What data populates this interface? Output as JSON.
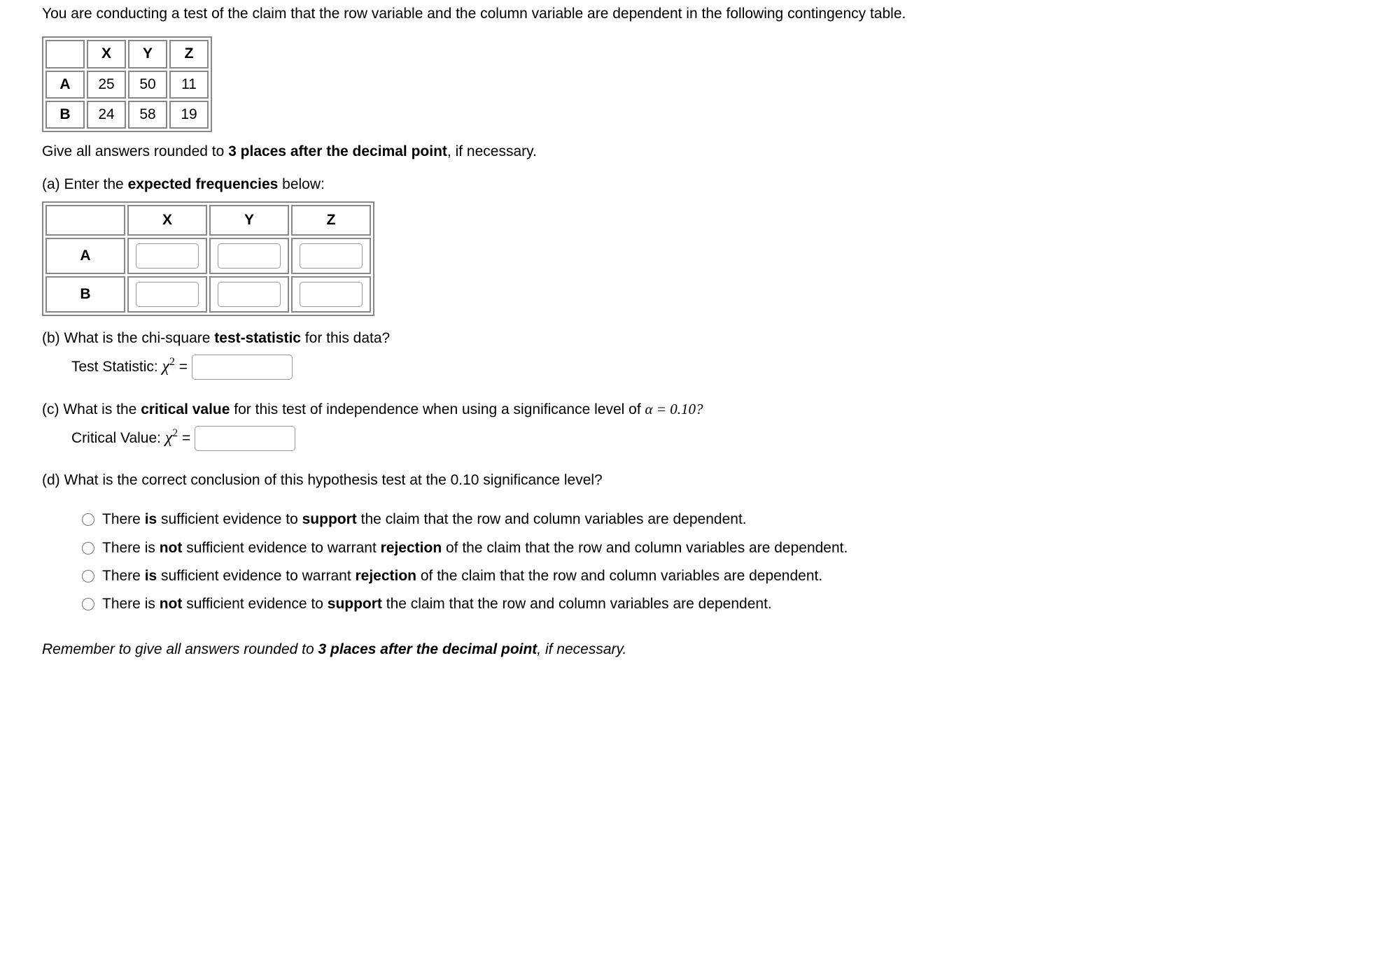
{
  "intro": "You are conducting a test of the claim that the row variable and the column variable are dependent in the following contingency table.",
  "contingency": {
    "cols": [
      "X",
      "Y",
      "Z"
    ],
    "rows": [
      {
        "label": "A",
        "cells": [
          "25",
          "50",
          "11"
        ]
      },
      {
        "label": "B",
        "cells": [
          "24",
          "58",
          "19"
        ]
      }
    ]
  },
  "rounding_instr_pre": "Give all answers rounded to ",
  "rounding_instr_bold": "3 places after the decimal point",
  "rounding_instr_post": ", if necessary.",
  "partA": {
    "text_pre": "(a) Enter the ",
    "text_bold": "expected frequencies",
    "text_post": " below:",
    "cols": [
      "X",
      "Y",
      "Z"
    ],
    "row_labels": [
      "A",
      "B"
    ]
  },
  "partB": {
    "text_pre": "(b) What is the chi-square ",
    "text_bold": "test-statistic",
    "text_post": " for this data?",
    "label": "Test Statistic: "
  },
  "partC": {
    "text_pre": "(c) What is the ",
    "text_bold": "critical value",
    "text_post": " for this test of independence when using a significance level of ",
    "alpha_eq": "α = 0.10?",
    "label": "Critical Value: "
  },
  "partD": {
    "text": "(d) What is the correct conclusion of this hypothesis test at the 0.10 significance level?",
    "options": [
      {
        "pre": "There ",
        "b1": "is",
        "mid1": " sufficient evidence to ",
        "b2": "support",
        "post": " the claim that the row and column variables are dependent."
      },
      {
        "pre": "There is ",
        "b1": "not",
        "mid1": " sufficient evidence to warrant ",
        "b2": "rejection",
        "post": " of the claim that the row and column variables are dependent."
      },
      {
        "pre": "There ",
        "b1": "is",
        "mid1": " sufficient evidence to warrant ",
        "b2": "rejection",
        "post": " of the claim that the row and column variables are dependent."
      },
      {
        "pre": "There is ",
        "b1": "not",
        "mid1": " sufficient evidence to ",
        "b2": "support",
        "post": " the claim that the row and column variables are dependent."
      }
    ]
  },
  "footer": {
    "pre": "Remember to give all answers rounded to ",
    "bold": "3 places after the decimal point",
    "post": ", if necessary."
  },
  "chi_html": "χ",
  "equals": " = "
}
